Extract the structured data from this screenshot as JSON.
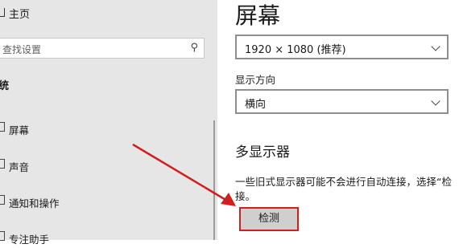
{
  "sidebar": {
    "home_label": "主页",
    "search_placeholder": "查找设置",
    "search_icon": "search-icon",
    "section_label": "统",
    "items": [
      {
        "label": "屏幕",
        "icon": "monitor-icon"
      },
      {
        "label": "声音",
        "icon": "speaker-icon"
      },
      {
        "label": "通知和操作",
        "icon": "notification-icon"
      },
      {
        "label": "专注助手",
        "icon": "moon-icon"
      }
    ]
  },
  "main": {
    "title": "屏幕",
    "resolution_value": "1920 × 1080 (推荐)",
    "orientation_label": "显示方向",
    "orientation_value": "横向",
    "multi_display_title": "多显示器",
    "multi_display_desc_line1": "一些旧式显示器可能不会进行自动连接，选择“检",
    "multi_display_desc_line2": "接。",
    "detect_button_label": "检测"
  },
  "colors": {
    "sidebar_bg": "#e6e6e6",
    "highlight_red": "#d11f1f",
    "button_bg": "#cfcfcf"
  }
}
